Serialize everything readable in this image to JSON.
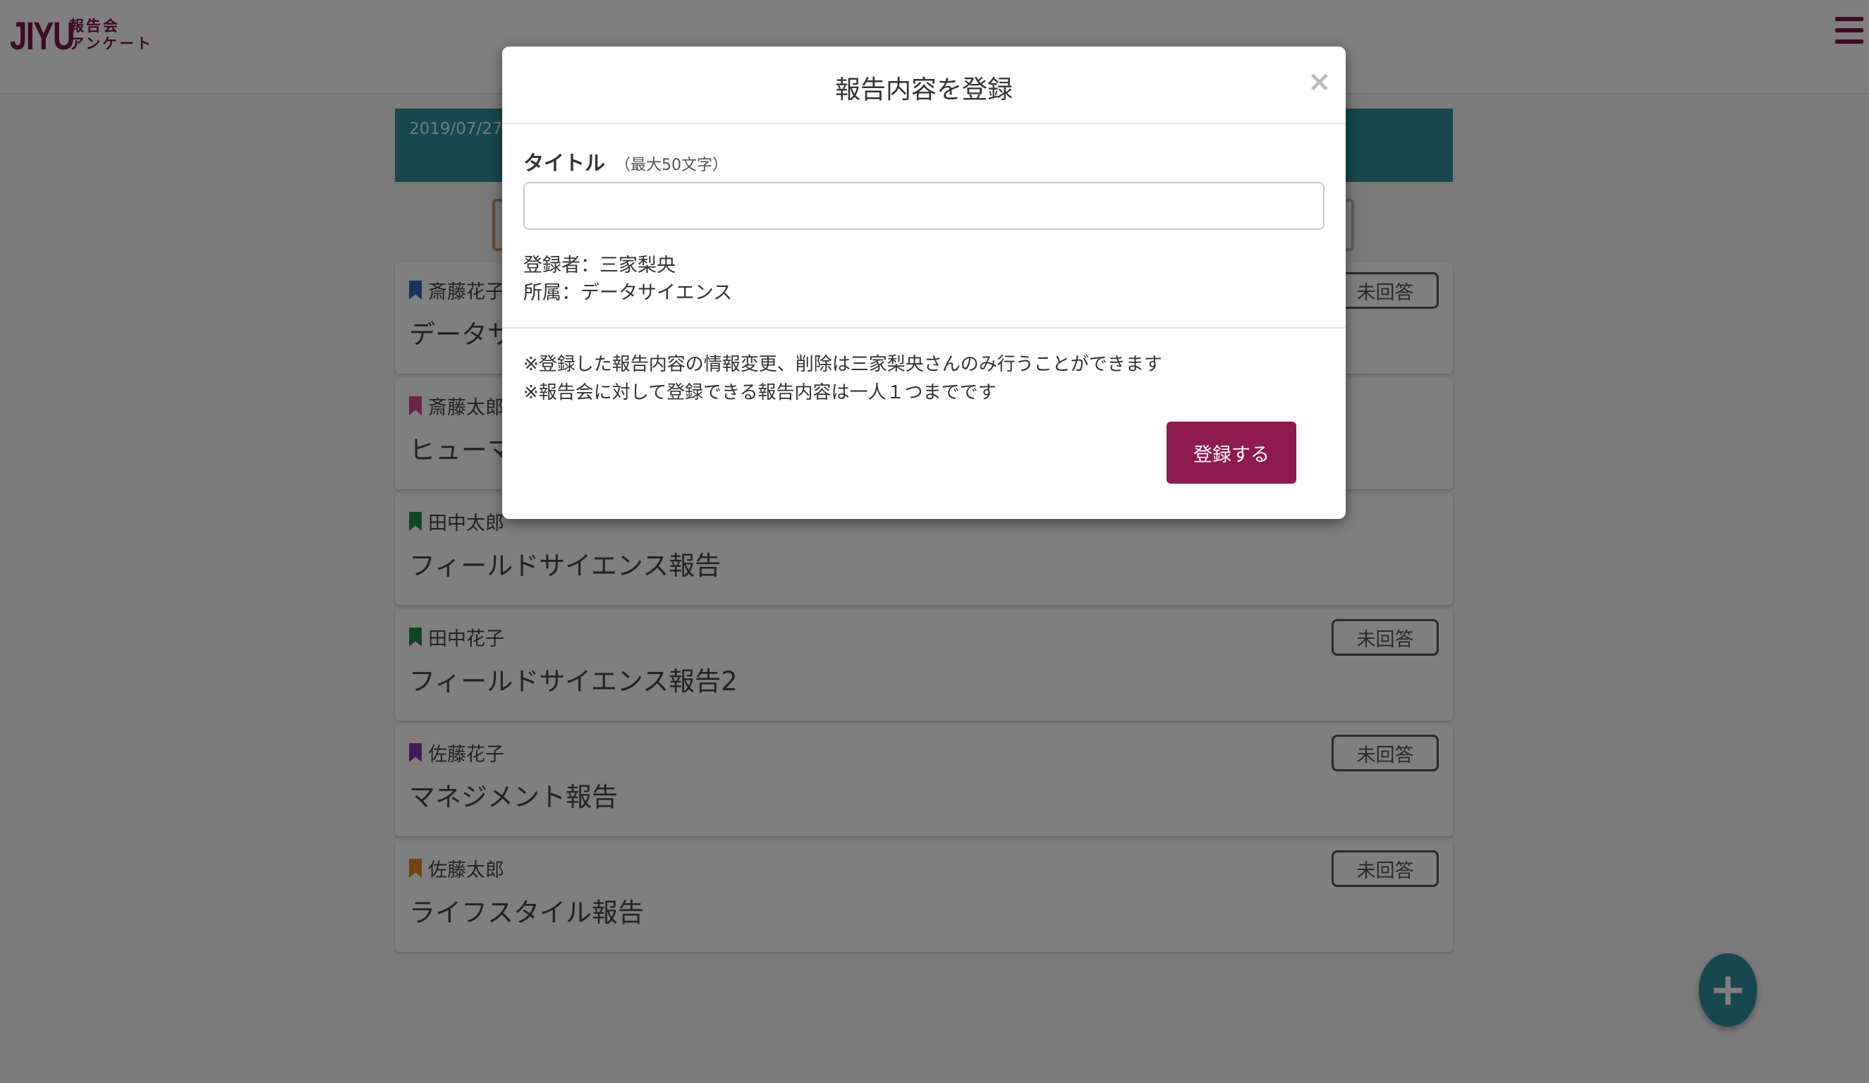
{
  "header": {
    "logo_main": "JIYU",
    "logo_sub_line1": "報告会",
    "logo_sub_line2": "アンケート"
  },
  "banner": {
    "date": "2019/07/27"
  },
  "cards": [
    {
      "author": "斎藤花子",
      "title": "データサイエンス報告",
      "status": "未回答",
      "color": "#2b6cb0"
    },
    {
      "author": "斎藤太郎",
      "title": "ヒューマン報告",
      "status": "",
      "color": "#d84a8a"
    },
    {
      "author": "田中太郎",
      "title": "フィールドサイエンス報告",
      "status": "",
      "color": "#1e8a4e"
    },
    {
      "author": "田中花子",
      "title": "フィールドサイエンス報告2",
      "status": "未回答",
      "color": "#1e8a4e"
    },
    {
      "author": "佐藤花子",
      "title": "マネジメント報告",
      "status": "未回答",
      "color": "#8a3aa8"
    },
    {
      "author": "佐藤太郎",
      "title": "ライフスタイル報告",
      "status": "未回答",
      "color": "#e28a1f"
    }
  ],
  "fab": {
    "label": "+"
  },
  "modal": {
    "title": "報告内容を登録",
    "close": "×",
    "field_label": "タイトル",
    "field_hint": "（最大50文字）",
    "title_value": "",
    "registrant": "登録者：三家梨央",
    "affiliation": "所属：データサイエンス",
    "note1": "※登録した報告内容の情報変更、削除は三家梨央さんのみ行うことができます",
    "note2": "※報告会に対して登録できる報告内容は一人１つまでです",
    "submit": "登録する"
  },
  "colors": {
    "brand": "#8e1a4f",
    "accent": "#2e8e9e"
  }
}
